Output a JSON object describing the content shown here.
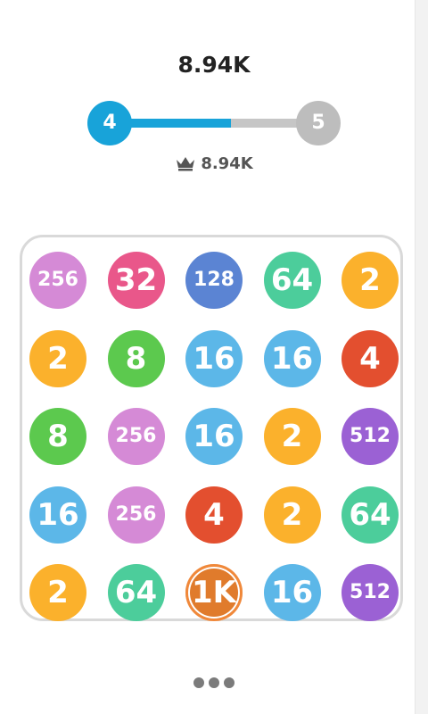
{
  "header": {
    "score": "8.94K",
    "best_score": "8.94K",
    "level": {
      "current": "4",
      "next": "5",
      "progress": 0.58
    }
  },
  "icons": {
    "best": "crown-icon",
    "menu": "more-dots-icon"
  },
  "colors": {
    "2": "#fbb12c",
    "4": "#e34f2f",
    "8": "#5cc94e",
    "16": "#5cb7e8",
    "32": "#e9578a",
    "64": "#4ccd9b",
    "128": "#5b84d3",
    "256": "#d58ad6",
    "512": "#9b61d4",
    "1K": "#e07b2c",
    "accent": "#18a3d9",
    "inactive": "#bdbdbd"
  },
  "board": {
    "rows": [
      [
        "256",
        "32",
        "128",
        "64",
        "2"
      ],
      [
        "2",
        "8",
        "16",
        "16",
        "4"
      ],
      [
        "8",
        "256",
        "16",
        "2",
        "512"
      ],
      [
        "16",
        "256",
        "4",
        "2",
        "64"
      ],
      [
        "2",
        "64",
        "1K",
        "16",
        "512"
      ]
    ]
  }
}
